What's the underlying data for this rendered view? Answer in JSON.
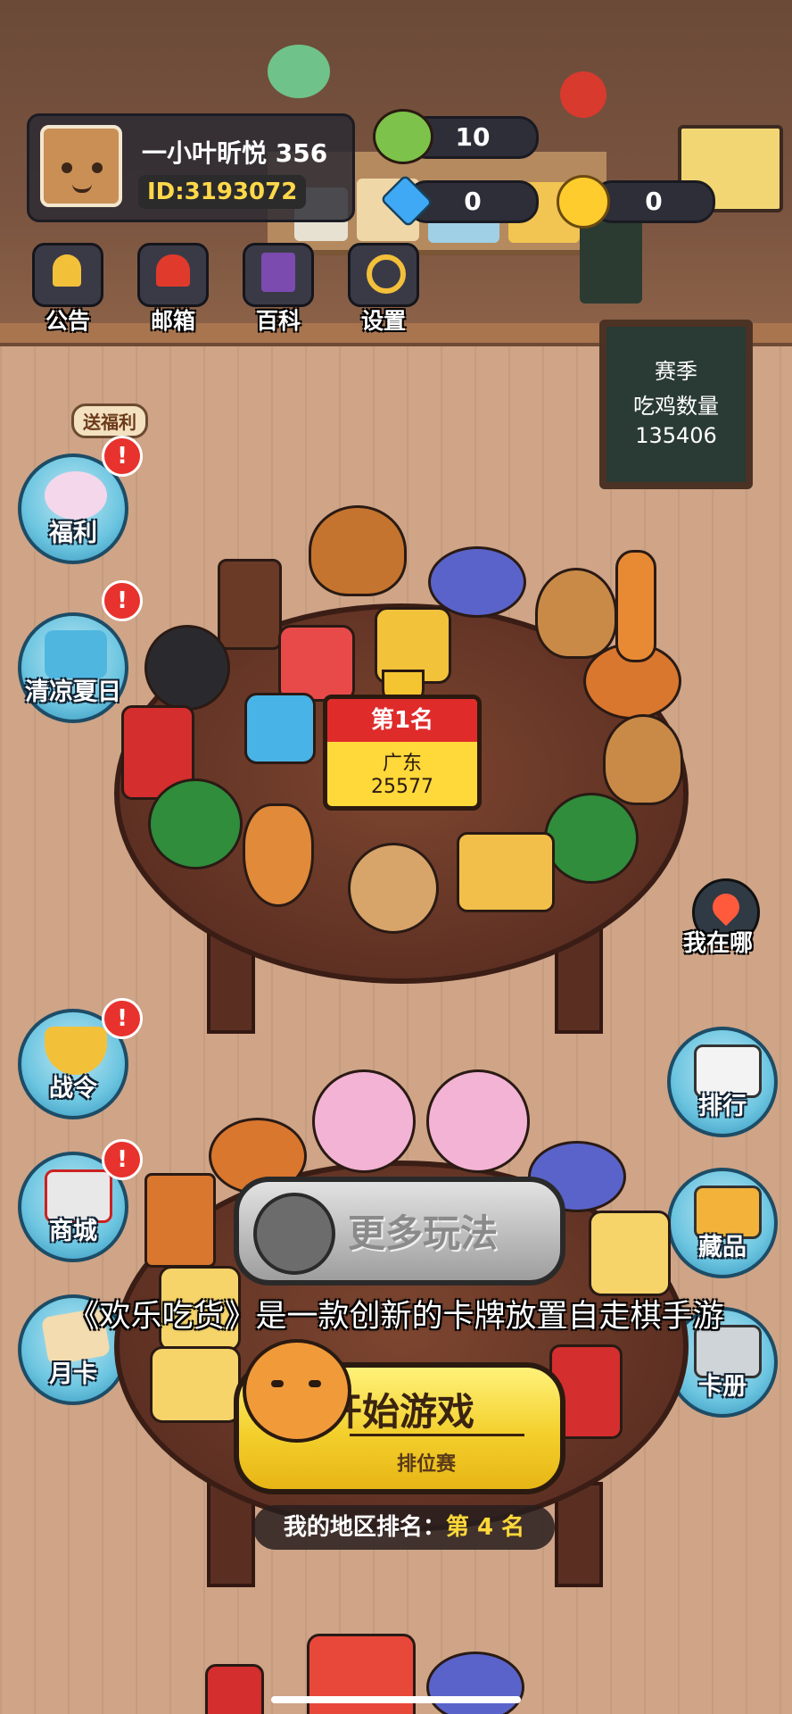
{
  "player": {
    "name": "一小叶昕悦 356",
    "id": "ID:3193072"
  },
  "resources": {
    "energy": "10",
    "diamonds": "0",
    "coins": "0"
  },
  "top_menu": [
    {
      "label": "公告",
      "icon": "bell-icon"
    },
    {
      "label": "邮箱",
      "icon": "mailbox-icon"
    },
    {
      "label": "百科",
      "icon": "book-icon"
    },
    {
      "label": "设置",
      "icon": "gear-icon"
    }
  ],
  "season_board": {
    "line1": "赛季",
    "line2": "吃鸡数量",
    "value": "135406"
  },
  "left_buttons": [
    {
      "label": "福利",
      "tag": "送福利",
      "badge": "!"
    },
    {
      "label": "清凉夏日",
      "badge": "!"
    },
    {
      "label": "战令",
      "badge": "!"
    },
    {
      "label": "商城",
      "badge": "!"
    },
    {
      "label": "月卡"
    }
  ],
  "right_buttons": [
    {
      "label": "我在哪"
    },
    {
      "label": "排行"
    },
    {
      "label": "藏品"
    },
    {
      "label": "卡册"
    }
  ],
  "rank_plate": {
    "title": "第1名",
    "region": "广东",
    "score": "25577"
  },
  "more_modes": {
    "label": "更多玩法"
  },
  "subtitle": "《欢乐吃货》是一款创新的卡牌放置自走棋手游",
  "start_button": {
    "label": "开始游戏",
    "mode": "排位赛"
  },
  "region_rank": {
    "prefix": "我的地区排名：",
    "value": "第 4 名"
  },
  "colors": {
    "gold": "#ffd83a",
    "red": "#e02b2b",
    "button_blue": "#6cc5e0",
    "start_yellow": "#f3cf2c"
  }
}
